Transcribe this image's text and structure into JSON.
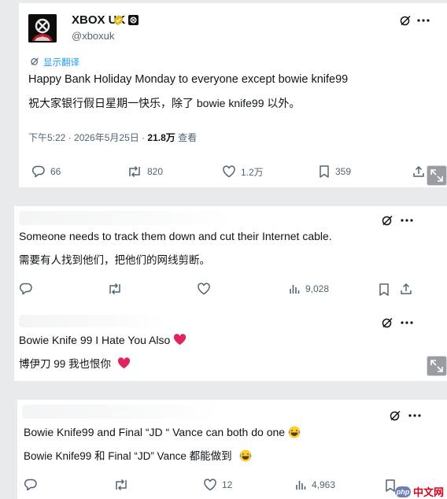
{
  "post": {
    "author_name": "XBOX UK",
    "handle": "@xboxuk",
    "translate_link": "显示翻译",
    "text": "Happy Bank Holiday Monday to everyone except bowie knife99",
    "translation": "祝大家银行假日星期一快乐，除了 bowie knife99 以外。",
    "timestamp": "下午5:22 · 2026年5月25日 · ",
    "views_count": "21.8万",
    "views_label": " 查看",
    "actions": {
      "replies": "66",
      "reposts": "820",
      "likes": "1.2万",
      "bookmarks": "359"
    }
  },
  "reply1": {
    "text": "Someone needs to track them down and cut their Internet cable.",
    "translation": "需要有人找到他们，把他们的网线剪断。",
    "actions": {
      "views": "9,028"
    }
  },
  "reply2": {
    "text": "Bowie Knife 99 I Hate You Also",
    "translation": "博伊刀 99 我也恨你"
  },
  "reply3": {
    "text": "Bowie Knife99 and Final “JD “ Vance can both do one",
    "translation": "Bowie Knife99 和 Final “JD” Vance 都能做到",
    "actions": {
      "likes": "12",
      "views": "4,963"
    }
  },
  "watermark": {
    "logo_text": "php",
    "label": "中文网"
  },
  "colors": {
    "accent": "#1d9bf0",
    "heart": "#e0245e",
    "watermark": "#d9001b"
  }
}
